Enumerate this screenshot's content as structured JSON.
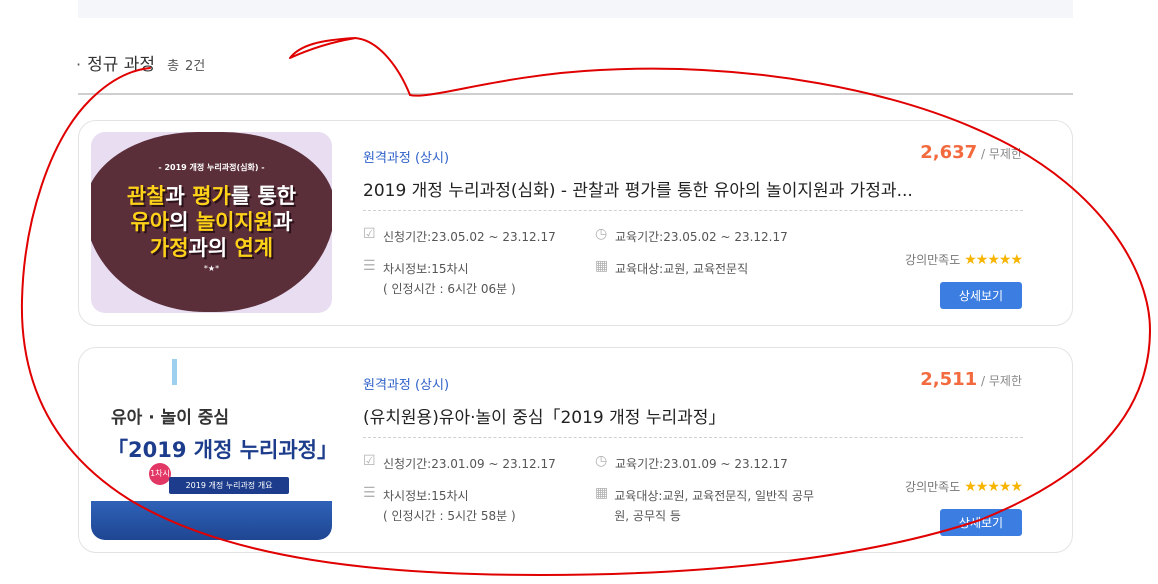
{
  "section": {
    "dot": "·",
    "title": "정규 과정",
    "count_prefix": "총",
    "count": "2건"
  },
  "courses": [
    {
      "type": "원격과정 (상시)",
      "title": "2019 개정 누리과정(심화) - 관찰과 평가를 통한 유아의 놀이지원과 가정과...",
      "students": "2,637",
      "limit": "/ 무제한",
      "apply_period": "신청기간:23.05.02 ~ 23.12.17",
      "edu_period": "교육기간:23.05.02 ~ 23.12.17",
      "session_info": "차시정보:15차시",
      "session_hours": "( 인정시간 : 6시간 06분 )",
      "target": "교육대상:교원, 교육전문직",
      "satisfaction_label": "강의만족도",
      "stars": "★★★★★",
      "rating": 5,
      "detail_label": "상세보기",
      "thumb": {
        "small": "- 2019 개정 누리과정(심화) -",
        "line1a": "관찰",
        "line1b": "과 ",
        "line1c": "평가",
        "line1d": "를 통한",
        "line2a": "유아",
        "line2b": "의 ",
        "line2c": "놀이지원",
        "line2d": "과",
        "line3a": "가정",
        "line3b": "과의 ",
        "line3c": "연계",
        "stars": "*★*"
      }
    },
    {
      "type": "원격과정 (상시)",
      "title": "(유치원용)유아·놀이 중심「2019 개정 누리과정」",
      "students": "2,511",
      "limit": "/ 무제한",
      "apply_period": "신청기간:23.01.09 ~ 23.12.17",
      "edu_period": "교육기간:23.01.09 ~ 23.12.17",
      "session_info": "차시정보:15차시",
      "session_hours": "( 인정시간 : 5시간 58분 )",
      "target": "교육대상:교원, 교육전문직, 일반직 공무원, 공무직 등",
      "satisfaction_label": "강의만족도",
      "stars": "★★★★★",
      "rating": 5,
      "detail_label": "상세보기",
      "thumb": {
        "line1": "유아 · 놀이 중심",
        "line2": "「2019 개정 누리과정」",
        "badge": "1차시",
        "pill": "2019 개정 누리과정 개요"
      }
    }
  ],
  "icons": {
    "apply": "check-square-icon",
    "edu": "clock-icon",
    "session": "list-icon",
    "target": "building-icon"
  },
  "colors": {
    "accent": "#3b7de0",
    "type_blue": "#2f62c9",
    "count_orange": "#f26a3d",
    "star": "#f7b400",
    "annotation_red": "#e00000"
  }
}
